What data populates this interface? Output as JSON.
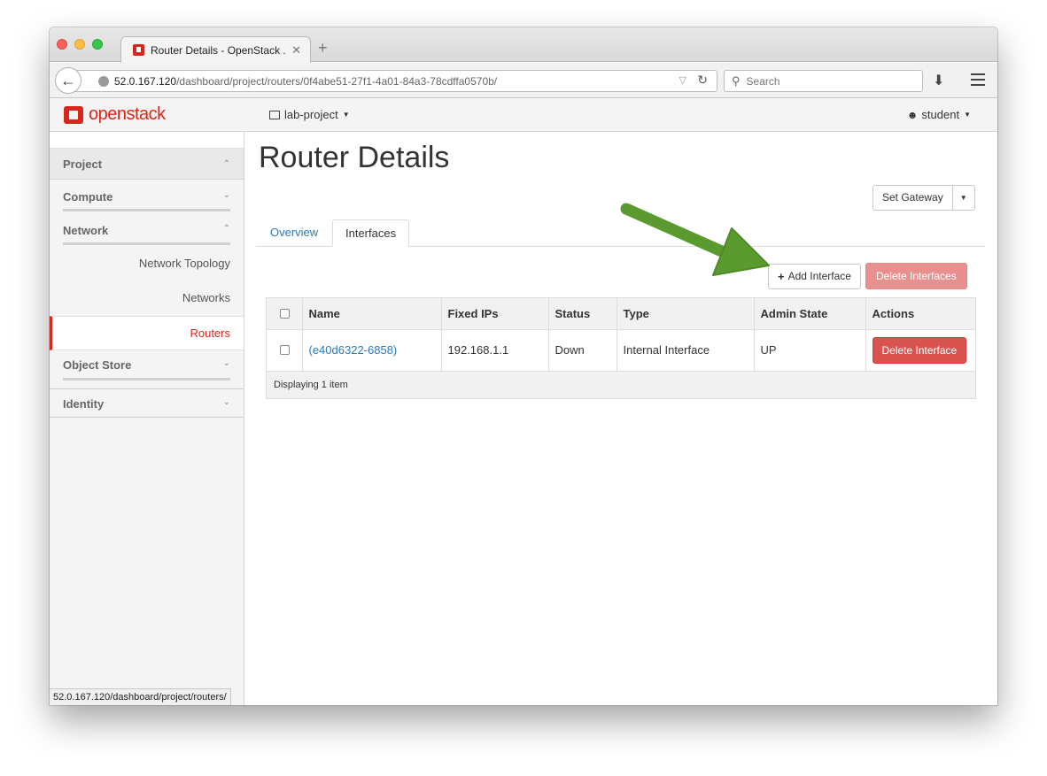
{
  "browser": {
    "tab_title": "Router Details - OpenStack ...",
    "tab_close": "✕",
    "new_tab": "+",
    "url_host": "52.0.167.120",
    "url_path": "/dashboard/project/routers/0f4abe51-27f1-4a01-84a3-78cdffa0570b/",
    "search_placeholder": "Search",
    "status_url": "52.0.167.120/dashboard/project/routers/"
  },
  "header": {
    "logo_text": "openstack",
    "project": "lab-project",
    "user": "student"
  },
  "sidebar": {
    "project_label": "Project",
    "groups": [
      {
        "label": "Compute"
      },
      {
        "label": "Network"
      },
      {
        "label": "Object Store"
      },
      {
        "label": "Identity"
      }
    ],
    "network_items": [
      {
        "label": "Network Topology"
      },
      {
        "label": "Networks"
      },
      {
        "label": "Routers",
        "active": true
      }
    ]
  },
  "page": {
    "title": "Router Details",
    "set_gateway": "Set Gateway",
    "tabs": [
      {
        "label": "Overview"
      },
      {
        "label": "Interfaces",
        "active": true
      }
    ],
    "add_interface": "Add Interface",
    "delete_interfaces": "Delete Interfaces"
  },
  "table": {
    "columns": [
      "Name",
      "Fixed IPs",
      "Status",
      "Type",
      "Admin State",
      "Actions"
    ],
    "rows": [
      {
        "name": "(e40d6322-6858)",
        "fixed_ips": "192.168.1.1",
        "status": "Down",
        "type": "Internal Interface",
        "admin_state": "UP",
        "action": "Delete Interface"
      }
    ],
    "footer": "Displaying 1 item"
  },
  "colors": {
    "accent_red": "#d9261c",
    "link_blue": "#2a7ab8",
    "danger": "#d9534f",
    "annotation_arrow": "#5a9a2e"
  }
}
